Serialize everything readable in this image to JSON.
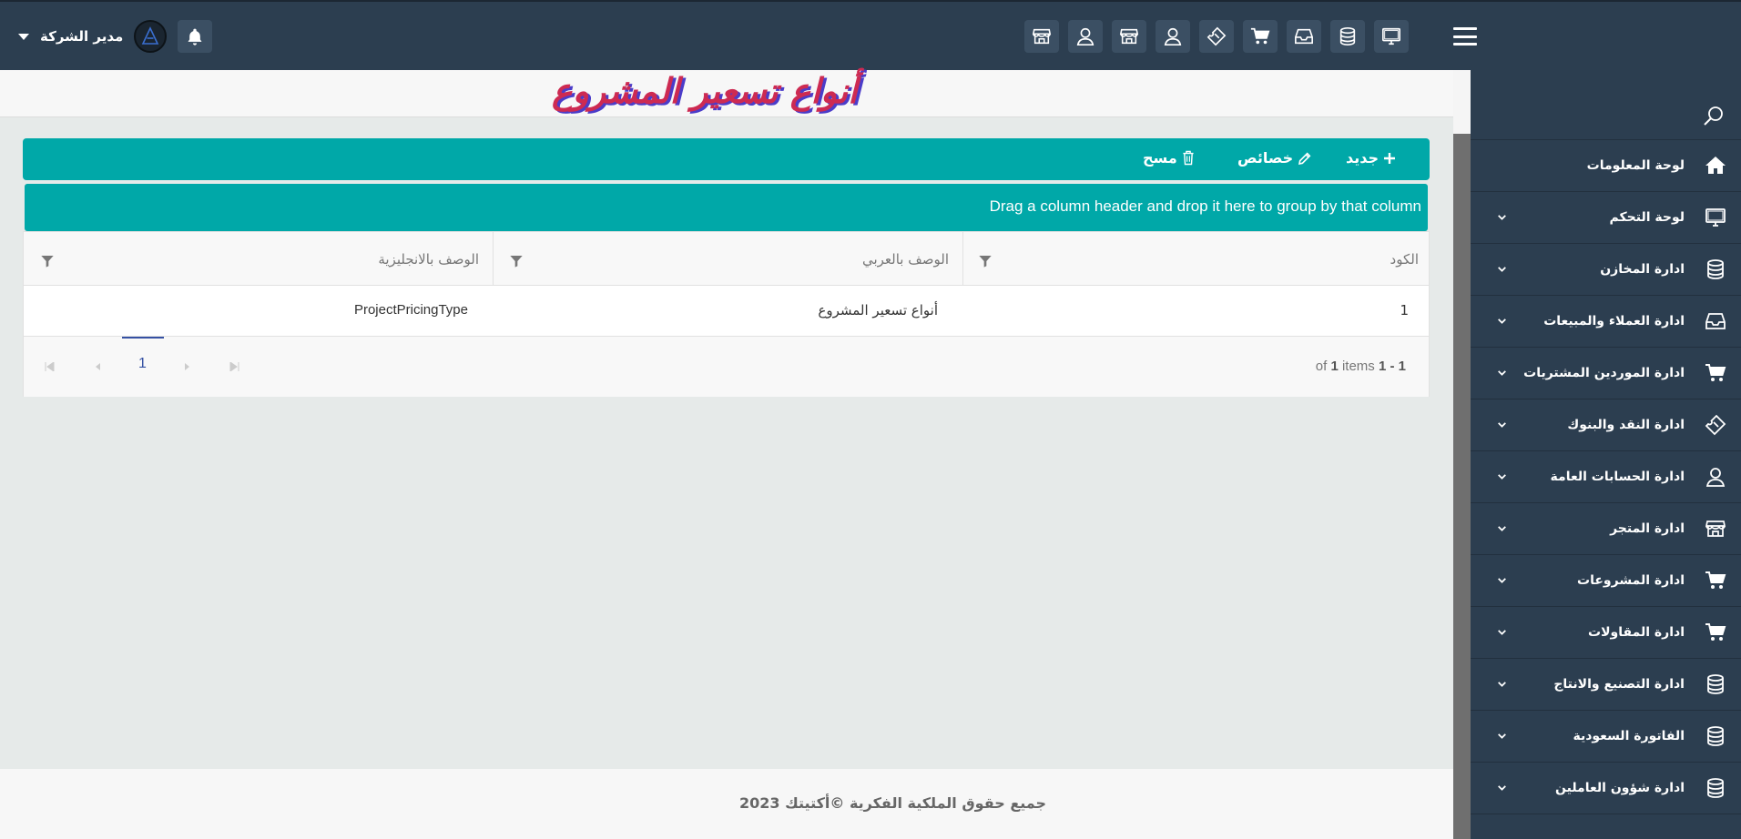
{
  "header": {
    "user_name": "مدير الشركة",
    "toolbar_icons": [
      "store-icon",
      "user-icon",
      "store-icon",
      "user-icon",
      "ticket-icon",
      "cart-icon",
      "inbox-icon",
      "database-icon",
      "monitor-icon"
    ]
  },
  "sidebar": {
    "items": [
      {
        "label": "لوحة المعلومات",
        "icon": "home-icon",
        "has_submenu": false
      },
      {
        "label": "لوحة التحكم",
        "icon": "monitor-icon",
        "has_submenu": true
      },
      {
        "label": "ادارة المخازن",
        "icon": "database-icon",
        "has_submenu": true
      },
      {
        "label": "ادارة العملاء والمبيعات",
        "icon": "inbox-icon",
        "has_submenu": true
      },
      {
        "label": "ادارة الموردين المشتريات",
        "icon": "cart-icon",
        "has_submenu": true
      },
      {
        "label": "ادارة النقد والبنوك",
        "icon": "ticket-icon",
        "has_submenu": true
      },
      {
        "label": "ادارة الحسابات العامة",
        "icon": "user-icon",
        "has_submenu": true
      },
      {
        "label": "ادارة المتجر",
        "icon": "store-icon",
        "has_submenu": true
      },
      {
        "label": "ادارة المشروعات",
        "icon": "cart-icon",
        "has_submenu": true
      },
      {
        "label": "ادارة المقاولات",
        "icon": "cart-icon",
        "has_submenu": true
      },
      {
        "label": "ادارة التصنيع والانتاج",
        "icon": "database-icon",
        "has_submenu": true
      },
      {
        "label": "الفاتورة السعودية",
        "icon": "database-icon",
        "has_submenu": true
      },
      {
        "label": "ادارة شؤون العاملين",
        "icon": "database-icon",
        "has_submenu": true
      }
    ]
  },
  "page": {
    "title": "أنواع تسعير المشروع"
  },
  "toolbar": {
    "new_label": "جديد",
    "edit_label": "خصائص",
    "delete_label": "مسح"
  },
  "grid": {
    "group_hint": "Drag a column header and drop it here to group by that column",
    "columns": [
      "الكود",
      "الوصف بالعربي",
      "الوصف بالانجليزية"
    ],
    "rows": [
      {
        "code": "1",
        "desc_ar": "أنواع تسعير المشروع",
        "desc_en": "ProjectPricingType"
      }
    ],
    "pager": {
      "range": "1 - 1",
      "of_text": "of",
      "total": "1",
      "items_text": "items",
      "current_page": "1"
    }
  },
  "footer": {
    "text": "جميع حقوق الملكية الفكرية ©أكتيتك 2023"
  },
  "colors": {
    "navbar": "#2c3e50",
    "accent": "#00a8a8",
    "title_red": "#cd2a52",
    "title_shadow": "#4b3cc9"
  }
}
